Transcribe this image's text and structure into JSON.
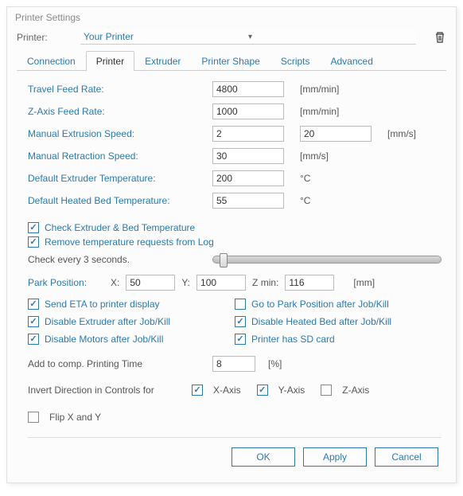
{
  "window": {
    "title": "Printer Settings"
  },
  "printer": {
    "label": "Printer:",
    "selected": "Your Printer"
  },
  "tabs": {
    "connection": "Connection",
    "printer": "Printer",
    "extruder": "Extruder",
    "shape": "Printer Shape",
    "scripts": "Scripts",
    "advanced": "Advanced"
  },
  "fields": {
    "travel_feed": {
      "label": "Travel Feed Rate:",
      "value": "4800",
      "unit": "[mm/min]"
    },
    "zaxis_feed": {
      "label": "Z-Axis Feed Rate:",
      "value": "1000",
      "unit": "[mm/min]"
    },
    "manual_extrusion": {
      "label": "Manual Extrusion Speed:",
      "value1": "2",
      "value2": "20",
      "unit": "[mm/s]"
    },
    "manual_retraction": {
      "label": "Manual Retraction Speed:",
      "value": "30",
      "unit": "[mm/s]"
    },
    "default_extruder_temp": {
      "label": "Default Extruder Temperature:",
      "value": "200",
      "unit": "°C"
    },
    "default_bed_temp": {
      "label": "Default Heated Bed Temperature:",
      "value": "55",
      "unit": "°C"
    }
  },
  "checks": {
    "check_temp": "Check Extruder & Bed Temperature",
    "remove_log": "Remove temperature requests from Log"
  },
  "slider": {
    "label": "Check every 3 seconds."
  },
  "park": {
    "label": "Park Position:",
    "x_label": "X:",
    "x": "50",
    "y_label": "Y:",
    "y": "100",
    "zmin_label": "Z min:",
    "zmin": "116",
    "unit": "[mm]"
  },
  "options": {
    "send_eta": "Send ETA to printer display",
    "goto_park": "Go to Park Position after Job/Kill",
    "disable_extruder": "Disable Extruder after Job/Kill",
    "disable_bed": "Disable Heated Bed after Job/Kill",
    "disable_motors": "Disable Motors after Job/Kill",
    "has_sd": "Printer has SD card"
  },
  "add_time": {
    "label": "Add to comp. Printing Time",
    "value": "8",
    "unit": "[%]"
  },
  "invert": {
    "label": "Invert Direction in Controls for",
    "x": "X-Axis",
    "y": "Y-Axis",
    "z": "Z-Axis",
    "flip": "Flip X and Y"
  },
  "buttons": {
    "ok": "OK",
    "apply": "Apply",
    "cancel": "Cancel"
  }
}
